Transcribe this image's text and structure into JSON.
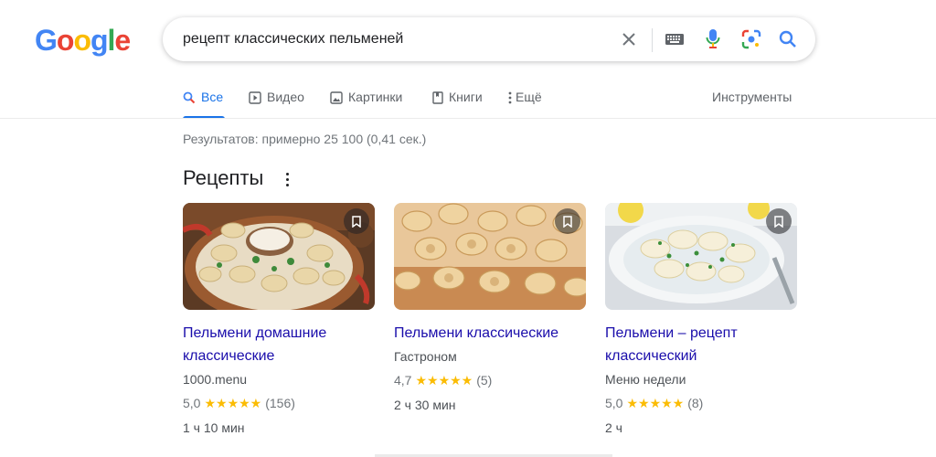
{
  "logo": {
    "letters": [
      "G",
      "o",
      "o",
      "g",
      "l",
      "e"
    ],
    "colors": [
      "#4285F4",
      "#EA4335",
      "#FBBC05",
      "#4285F4",
      "#34A853",
      "#EA4335"
    ]
  },
  "search": {
    "query": "рецепт классических пельменей",
    "icons": [
      "close-icon",
      "keyboard-icon",
      "mic-icon",
      "lens-icon",
      "search-icon"
    ]
  },
  "tabs": [
    {
      "label": "Все",
      "icon": "search-icon",
      "active": true
    },
    {
      "label": "Видео",
      "icon": "play-icon",
      "active": false
    },
    {
      "label": "Картинки",
      "icon": "image-icon",
      "active": false
    },
    {
      "label": "Книги",
      "icon": "book-icon",
      "active": false
    },
    {
      "label": "Ещё",
      "icon": "more-vert-icon",
      "active": false
    }
  ],
  "tools_label": "Инструменты",
  "results_stats": "Результатов: примерно 25 100 (0,41 сек.)",
  "section_title": "Рецепты",
  "recipes": [
    {
      "title_line1": "Пельмени домашние",
      "title_line2": "классические",
      "source": "1000.menu",
      "rating": "5,0",
      "stars": "★★★★★",
      "count": "(156)",
      "time": "1 ч 10 мин"
    },
    {
      "title_line1": "Пельмени классические",
      "title_line2": "",
      "source": "Гастроном",
      "rating": "4,7",
      "stars": "★★★★★",
      "count": "(5)",
      "time": "2 ч 30 мин"
    },
    {
      "title_line1": "Пельмени – рецепт",
      "title_line2": "классический",
      "source": "Меню недели",
      "rating": "5,0",
      "stars": "★★★★★",
      "count": "(8)",
      "time": "2 ч"
    }
  ],
  "colors": {
    "link": "#1a0dab",
    "accent": "#1a73e8",
    "star": "#fbbc04"
  }
}
